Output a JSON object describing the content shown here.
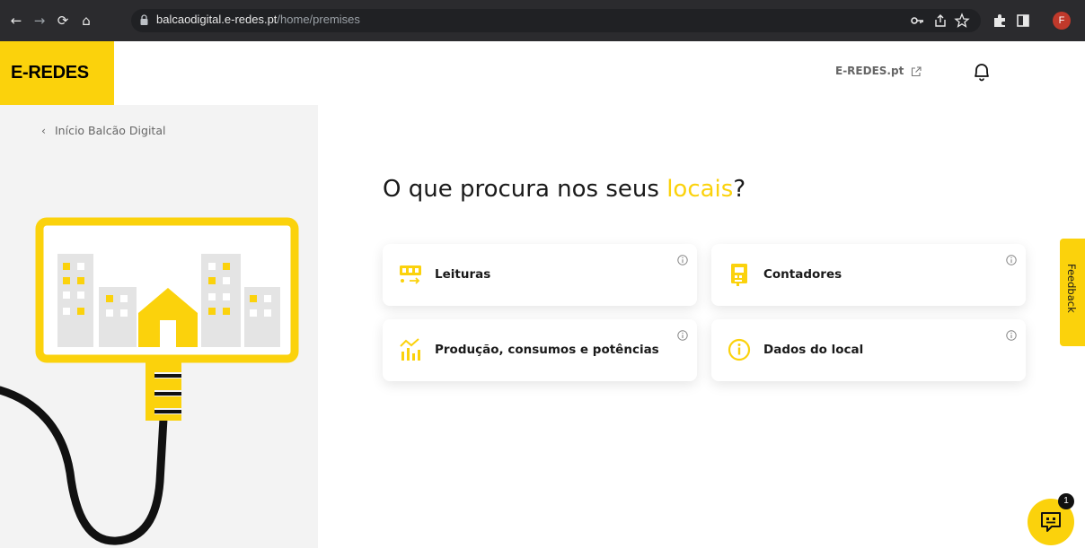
{
  "browser": {
    "url_host": "balcaodigital.e-redes.pt",
    "url_path": "/home/premises",
    "profile_initial": "F"
  },
  "header": {
    "logo_text": "E-REDES",
    "site_link": "E-REDES.pt"
  },
  "sidebar": {
    "back_label": "Início Balcão Digital"
  },
  "main": {
    "heading_prefix": "O que procura nos seus ",
    "heading_highlight": "locais",
    "heading_suffix": "?",
    "cards": [
      {
        "label": "Leituras",
        "icon": "meter-reading-icon"
      },
      {
        "label": "Contadores",
        "icon": "meter-device-icon"
      },
      {
        "label": "Produção, consumos e potências",
        "icon": "consumption-chart-icon"
      },
      {
        "label": "Dados do local",
        "icon": "info-circle-icon"
      }
    ]
  },
  "feedback_tab": {
    "label": "Feedback"
  },
  "chat": {
    "badge_count": "1"
  },
  "colors": {
    "brand_yellow": "#fbd20c",
    "panel_gray": "#f3f3f3"
  }
}
